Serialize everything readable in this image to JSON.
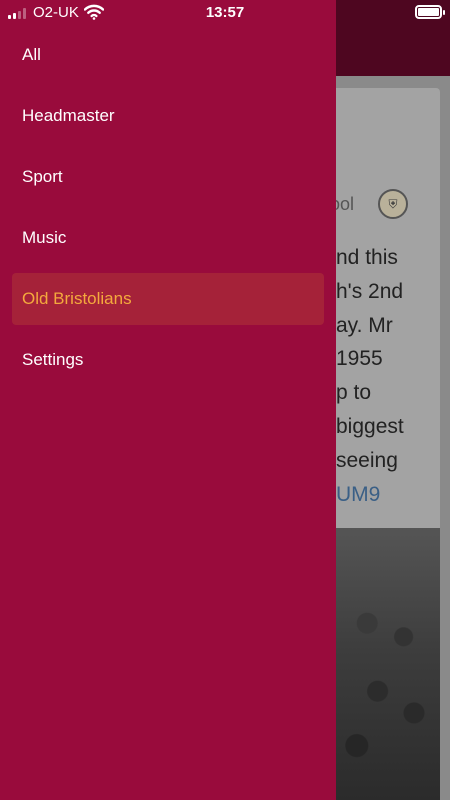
{
  "status_bar": {
    "carrier": "O2-UK",
    "time": "13:57",
    "battery_level": 1.0,
    "signal_bars": 2
  },
  "background_content": {
    "source_name_fragment": "hool",
    "text_lines": [
      "nd this",
      "h's 2nd",
      "ay. Mr",
      "1955",
      "p to",
      "biggest",
      "seeing"
    ],
    "link_fragment": "UM9"
  },
  "menu": {
    "items": [
      {
        "label": "All"
      },
      {
        "label": "Headmaster"
      },
      {
        "label": "Sport"
      },
      {
        "label": "Music"
      },
      {
        "label": "Old Bristolians",
        "active": true
      },
      {
        "label": "Settings"
      }
    ]
  },
  "colors": {
    "drawer_bg": "#990b3c",
    "active_item_bg": "#a52239",
    "active_item_text": "#f4a93d",
    "header_bg": "#4e0620"
  }
}
